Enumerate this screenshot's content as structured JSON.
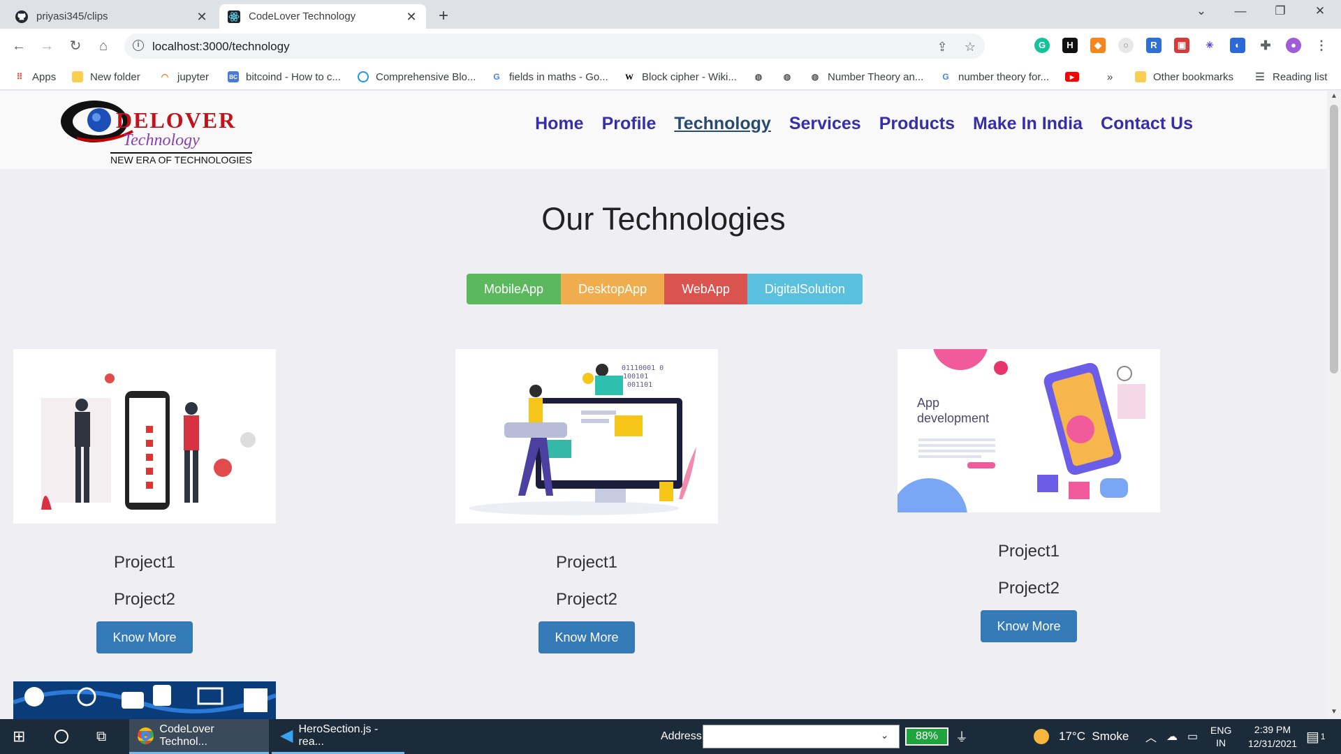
{
  "browser": {
    "tabs": [
      {
        "title": "priyasi345/clips",
        "favicon": "github-icon",
        "active": false
      },
      {
        "title": "CodeLover Technology",
        "favicon": "react-icon",
        "active": true
      }
    ],
    "url": "localhost:3000/technology",
    "bookmarks": [
      {
        "label": "Apps",
        "icon": "apps-grid-icon"
      },
      {
        "label": "New folder",
        "icon": "folder-icon"
      },
      {
        "label": "jupyter",
        "icon": "jupyter-icon"
      },
      {
        "label": "bitcoind - How to c...",
        "icon": "bc-icon"
      },
      {
        "label": "Comprehensive Blo...",
        "icon": "globe-icon"
      },
      {
        "label": "fields in maths - Go...",
        "icon": "google-icon"
      },
      {
        "label": "Block cipher - Wiki...",
        "icon": "wikipedia-icon"
      },
      {
        "label": "Number Theory an...",
        "icon": "globe-icon"
      },
      {
        "label": "number theory for...",
        "icon": "google-icon"
      },
      {
        "label": "Other bookmarks",
        "icon": "folder-icon"
      },
      {
        "label": "Reading list",
        "icon": "reading-list-icon"
      }
    ],
    "overflow_label": "»"
  },
  "site": {
    "logo": {
      "brand": "DELOVER",
      "sub": "Technology",
      "tagline": "NEW ERA OF TECHNOLOGIES"
    },
    "nav": [
      "Home",
      "Profile",
      "Technology",
      "Services",
      "Products",
      "Make In India",
      "Contact Us"
    ],
    "active_nav": "Technology",
    "section_title": "Our Technologies",
    "filters": [
      "MobileApp",
      "DesktopApp",
      "WebApp",
      "DigitalSolution"
    ],
    "cards": [
      {
        "projects": [
          "Project1",
          "Project2"
        ],
        "button": "Know More"
      },
      {
        "projects": [
          "Project1",
          "Project2"
        ],
        "button": "Know More"
      },
      {
        "projects": [
          "Project1",
          "Project2"
        ],
        "button": "Know More",
        "image_text": "App development"
      }
    ],
    "binary_text": [
      "01110001 0",
      "100101",
      "001101"
    ]
  },
  "taskbar": {
    "apps": [
      {
        "label": "CodeLover Technol...",
        "icon": "chrome-icon"
      },
      {
        "label": "HeroSection.js - rea...",
        "icon": "vscode-icon"
      }
    ],
    "address_label": "Address",
    "battery": "88%",
    "weather": "17°C  Smoke",
    "lang": "ENG",
    "region": "IN",
    "time": "2:39 PM",
    "date": "12/31/2021",
    "notifications": "1"
  }
}
